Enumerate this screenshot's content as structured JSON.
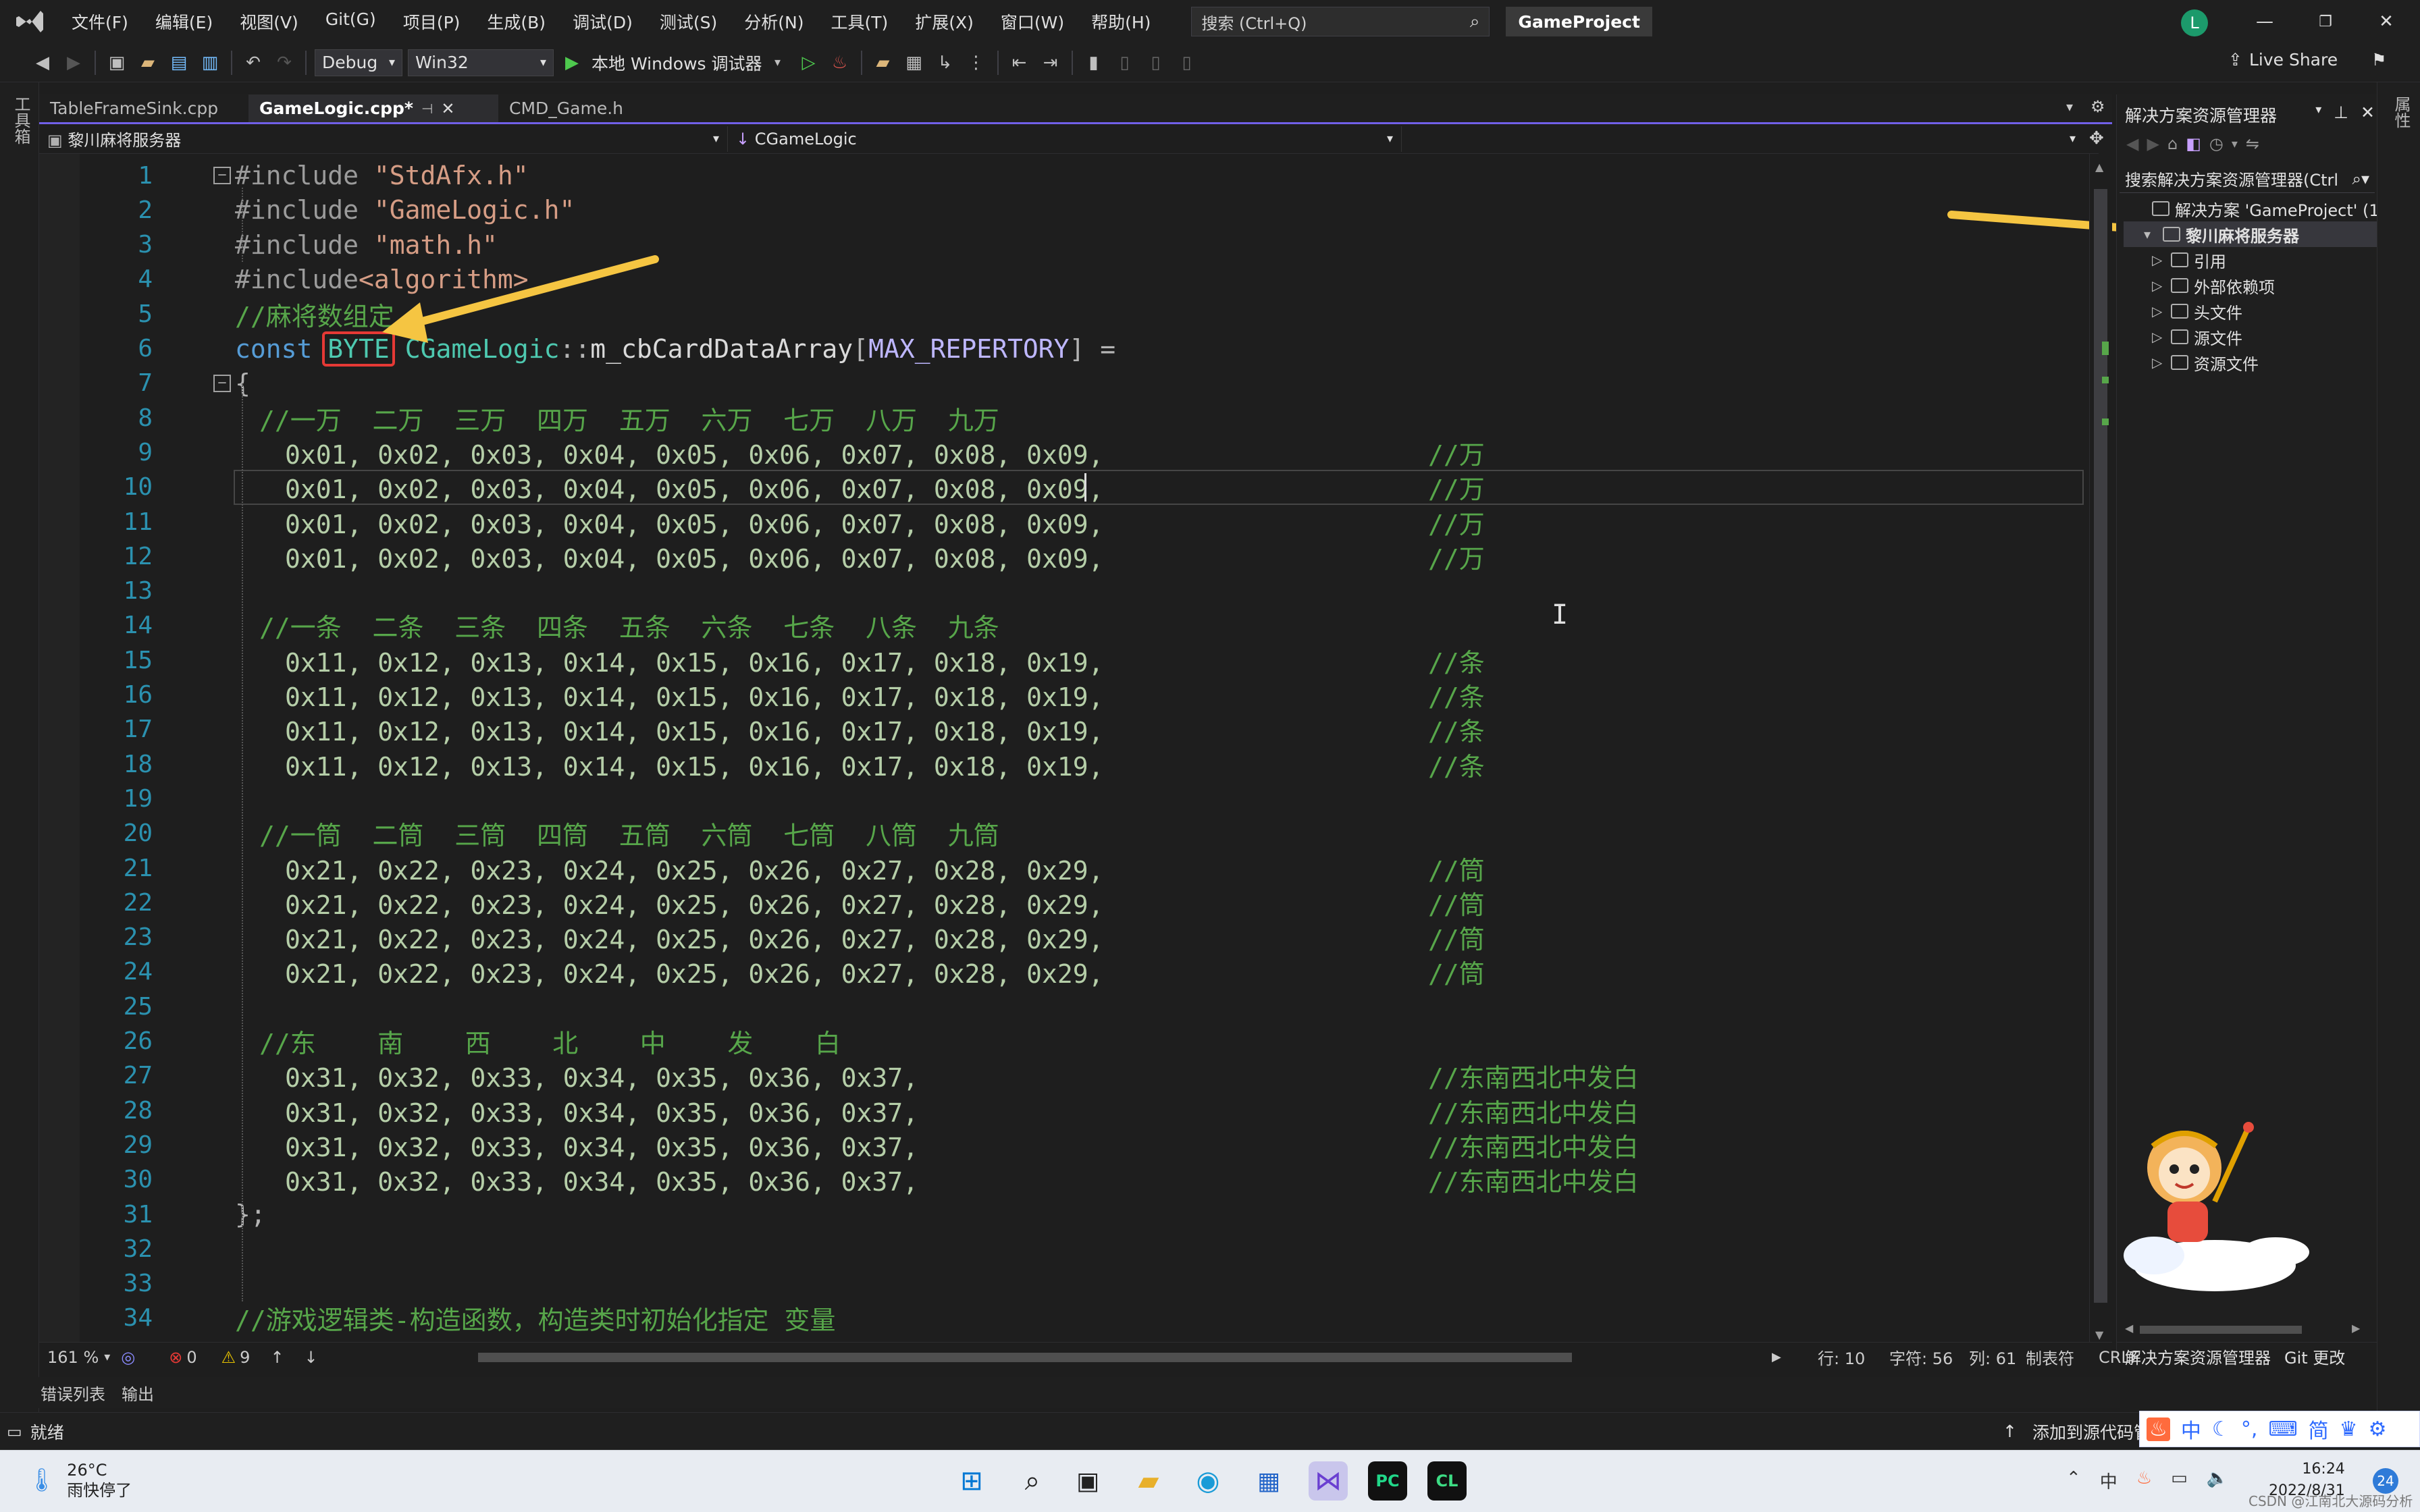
{
  "titlebar": {
    "menus": [
      "文件(F)",
      "编辑(E)",
      "视图(V)",
      "Git(G)",
      "项目(P)",
      "生成(B)",
      "调试(D)",
      "测试(S)",
      "分析(N)",
      "工具(T)",
      "扩展(X)",
      "窗口(W)",
      "帮助(H)"
    ],
    "search_placeholder": "搜索 (Ctrl+Q)",
    "project_name": "GameProject",
    "avatar_letter": "L"
  },
  "toolbar": {
    "config": "Debug",
    "platform": "Win32",
    "run_label": "本地 Windows 调试器",
    "live_share": "Live Share"
  },
  "left_strip_label": "工具箱",
  "right_strip_label": "属性",
  "tabs": [
    {
      "label": "TableFrameSink.cpp",
      "active": false
    },
    {
      "label": "GameLogic.cpp*",
      "active": true
    },
    {
      "label": "CMD_Game.h",
      "active": false
    }
  ],
  "navbar": {
    "project": "黎川麻将服务器",
    "scope": "CGameLogic"
  },
  "code": {
    "lines": [
      {
        "n": "1",
        "fold": "minus",
        "parts": [
          [
            "pp",
            "#include "
          ],
          [
            "str",
            "\"StdAfx.h\""
          ]
        ],
        "indent": 0
      },
      {
        "n": "2",
        "parts": [
          [
            "pp",
            "#include "
          ],
          [
            "str",
            "\"GameLogic.h\""
          ]
        ],
        "indent": 0
      },
      {
        "n": "3",
        "parts": [
          [
            "pp",
            "#include "
          ],
          [
            "str",
            "\"math.h\""
          ]
        ],
        "indent": 0
      },
      {
        "n": "4",
        "parts": [
          [
            "pp",
            "#include"
          ],
          [
            "str",
            "<algorithm>"
          ]
        ],
        "indent": 0
      },
      {
        "n": "5",
        "parts": [
          [
            "cm",
            "//麻将数组定"
          ]
        ],
        "indent": 0
      },
      {
        "n": "6",
        "parts": [
          [
            "kw",
            "const "
          ],
          [
            "type",
            "BYTE"
          ],
          [
            "id",
            " "
          ],
          [
            "type",
            "CGameLogic"
          ],
          [
            "pun",
            "::"
          ],
          [
            "id",
            "m_cbCardDataArray"
          ],
          [
            "pun",
            "["
          ],
          [
            "macro",
            "MAX_REPERTORY"
          ],
          [
            "pun",
            "] ="
          ]
        ],
        "indent": 0
      },
      {
        "n": "7",
        "fold": "minus",
        "parts": [
          [
            "pun",
            "{"
          ]
        ],
        "indent": 0
      },
      {
        "n": "8",
        "parts": [
          [
            "cm",
            "//一万  二万  三万  四万  五万  六万  七万  八万  九万"
          ]
        ],
        "indent": 1
      },
      {
        "n": "9",
        "parts": [
          [
            "num",
            "0x01, 0x02, 0x03, 0x04, 0x05, 0x06, 0x07, 0x08, 0x09,"
          ],
          [
            "id",
            "                     "
          ],
          [
            "cm",
            "//万"
          ]
        ],
        "indent": 2
      },
      {
        "n": "10",
        "parts": [
          [
            "num",
            "0x01, 0x02, 0x03, 0x04, 0x05, 0x06, 0x07, 0x08, 0x09,"
          ],
          [
            "id",
            "                     "
          ],
          [
            "cm",
            "//万"
          ]
        ],
        "indent": 2
      },
      {
        "n": "11",
        "parts": [
          [
            "num",
            "0x01, 0x02, 0x03, 0x04, 0x05, 0x06, 0x07, 0x08, 0x09,"
          ],
          [
            "id",
            "                     "
          ],
          [
            "cm",
            "//万"
          ]
        ],
        "indent": 2
      },
      {
        "n": "12",
        "parts": [
          [
            "num",
            "0x01, 0x02, 0x03, 0x04, 0x05, 0x06, 0x07, 0x08, 0x09,"
          ],
          [
            "id",
            "                     "
          ],
          [
            "cm",
            "//万"
          ]
        ],
        "indent": 2
      },
      {
        "n": "13",
        "parts": [],
        "indent": 0
      },
      {
        "n": "14",
        "parts": [
          [
            "cm",
            "//一条  二条  三条  四条  五条  六条  七条  八条  九条"
          ]
        ],
        "indent": 1
      },
      {
        "n": "15",
        "parts": [
          [
            "num",
            "0x11, 0x12, 0x13, 0x14, 0x15, 0x16, 0x17, 0x18, 0x19,"
          ],
          [
            "id",
            "                     "
          ],
          [
            "cm",
            "//条"
          ]
        ],
        "indent": 2
      },
      {
        "n": "16",
        "parts": [
          [
            "num",
            "0x11, 0x12, 0x13, 0x14, 0x15, 0x16, 0x17, 0x18, 0x19,"
          ],
          [
            "id",
            "                     "
          ],
          [
            "cm",
            "//条"
          ]
        ],
        "indent": 2
      },
      {
        "n": "17",
        "parts": [
          [
            "num",
            "0x11, 0x12, 0x13, 0x14, 0x15, 0x16, 0x17, 0x18, 0x19,"
          ],
          [
            "id",
            "                     "
          ],
          [
            "cm",
            "//条"
          ]
        ],
        "indent": 2
      },
      {
        "n": "18",
        "parts": [
          [
            "num",
            "0x11, 0x12, 0x13, 0x14, 0x15, 0x16, 0x17, 0x18, 0x19,"
          ],
          [
            "id",
            "                     "
          ],
          [
            "cm",
            "//条"
          ]
        ],
        "indent": 2
      },
      {
        "n": "19",
        "parts": [],
        "indent": 0
      },
      {
        "n": "20",
        "parts": [
          [
            "cm",
            "//一筒  二筒  三筒  四筒  五筒  六筒  七筒  八筒  九筒"
          ]
        ],
        "indent": 1
      },
      {
        "n": "21",
        "parts": [
          [
            "num",
            "0x21, 0x22, 0x23, 0x24, 0x25, 0x26, 0x27, 0x28, 0x29,"
          ],
          [
            "id",
            "                     "
          ],
          [
            "cm",
            "//筒"
          ]
        ],
        "indent": 2
      },
      {
        "n": "22",
        "parts": [
          [
            "num",
            "0x21, 0x22, 0x23, 0x24, 0x25, 0x26, 0x27, 0x28, 0x29,"
          ],
          [
            "id",
            "                     "
          ],
          [
            "cm",
            "//筒"
          ]
        ],
        "indent": 2
      },
      {
        "n": "23",
        "parts": [
          [
            "num",
            "0x21, 0x22, 0x23, 0x24, 0x25, 0x26, 0x27, 0x28, 0x29,"
          ],
          [
            "id",
            "                     "
          ],
          [
            "cm",
            "//筒"
          ]
        ],
        "indent": 2
      },
      {
        "n": "24",
        "parts": [
          [
            "num",
            "0x21, 0x22, 0x23, 0x24, 0x25, 0x26, 0x27, 0x28, 0x29,"
          ],
          [
            "id",
            "                     "
          ],
          [
            "cm",
            "//筒"
          ]
        ],
        "indent": 2
      },
      {
        "n": "25",
        "parts": [],
        "indent": 0
      },
      {
        "n": "26",
        "parts": [
          [
            "cm",
            "//东    南    西    北    中    发    白"
          ]
        ],
        "indent": 1
      },
      {
        "n": "27",
        "parts": [
          [
            "num",
            "0x31, 0x32, 0x33, 0x34, 0x35, 0x36, 0x37,"
          ],
          [
            "id",
            "                                 "
          ],
          [
            "cm",
            "//东南西北中发白"
          ]
        ],
        "indent": 2
      },
      {
        "n": "28",
        "parts": [
          [
            "num",
            "0x31, 0x32, 0x33, 0x34, 0x35, 0x36, 0x37,"
          ],
          [
            "id",
            "                                 "
          ],
          [
            "cm",
            "//东南西北中发白"
          ]
        ],
        "indent": 2
      },
      {
        "n": "29",
        "parts": [
          [
            "num",
            "0x31, 0x32, 0x33, 0x34, 0x35, 0x36, 0x37,"
          ],
          [
            "id",
            "                                 "
          ],
          [
            "cm",
            "//东南西北中发白"
          ]
        ],
        "indent": 2
      },
      {
        "n": "30",
        "parts": [
          [
            "num",
            "0x31, 0x32, 0x33, 0x34, 0x35, 0x36, 0x37,"
          ],
          [
            "id",
            "                                 "
          ],
          [
            "cm",
            "//东南西北中发白"
          ]
        ],
        "indent": 2
      },
      {
        "n": "31",
        "parts": [
          [
            "pun",
            "};"
          ]
        ],
        "indent": 0
      },
      {
        "n": "32",
        "parts": [],
        "indent": 0
      },
      {
        "n": "33",
        "parts": [],
        "indent": 0
      },
      {
        "n": "34",
        "parts": [
          [
            "cm",
            "//游戏逻辑类-构造函数，构造类时初始化指定 变量"
          ]
        ],
        "indent": 0
      }
    ]
  },
  "editor_status": {
    "zoom": "161 %",
    "errors": "0",
    "warnings": "9",
    "line": "行: 10",
    "char": "字符: 56",
    "col": "列: 61",
    "tab_mode": "制表符",
    "eol": "CRLF"
  },
  "bottom_tabs": [
    "错误列表",
    "输出"
  ],
  "statusbar": {
    "ready": "就绪",
    "source_control": "添加到源代码管"
  },
  "solution_explorer": {
    "title": "解决方案资源管理器",
    "search": "搜索解决方案资源管理器(Ctrl",
    "items": [
      {
        "label": "解决方案 'GameProject' (1 个",
        "level": 0,
        "selected": false,
        "expand": ""
      },
      {
        "label": "黎川麻将服务器",
        "level": 1,
        "selected": true,
        "expand": "▾"
      },
      {
        "label": "引用",
        "level": 2,
        "selected": false,
        "expand": "▷"
      },
      {
        "label": "外部依赖项",
        "level": 2,
        "selected": false,
        "expand": "▷"
      },
      {
        "label": "头文件",
        "level": 2,
        "selected": false,
        "expand": "▷"
      },
      {
        "label": "源文件",
        "level": 2,
        "selected": false,
        "expand": "▷"
      },
      {
        "label": "资源文件",
        "level": 2,
        "selected": false,
        "expand": "▷"
      }
    ],
    "footer_tabs": [
      "解决方案资源管理器",
      "Git 更改"
    ]
  },
  "ime_bar": [
    "中",
    "简"
  ],
  "taskbar": {
    "temperature": "26°C",
    "weather": "雨快停了",
    "time": "16:24",
    "date": "2022/8/31",
    "notifications": "24",
    "ime_lang": "中"
  },
  "watermark": "CSDN @江南北大源码分析",
  "colors": {
    "accent": "#7160e8",
    "annotation_arrow": "#f5c542",
    "highlight_box": "#e53935"
  }
}
